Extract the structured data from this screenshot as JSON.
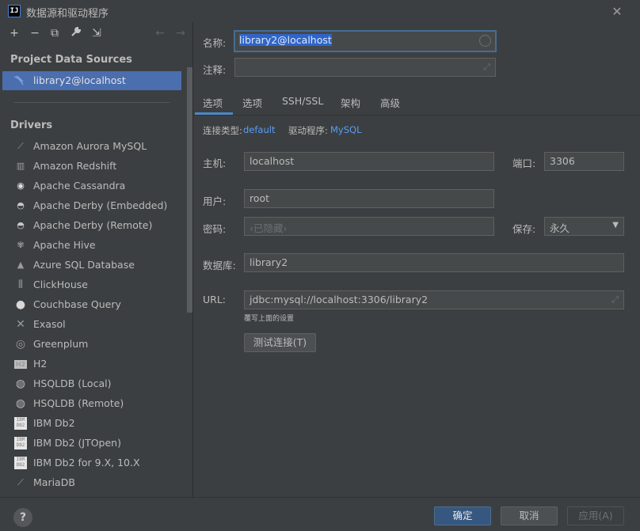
{
  "window": {
    "title": "数据源和驱动程序",
    "app_icon": "IJ",
    "close_icon": "✕"
  },
  "sidebar": {
    "toolbar": {
      "add": "+",
      "remove": "−",
      "copy": "⧉",
      "settings": "🔧",
      "import": "⇲",
      "back": "←",
      "forward": "→"
    },
    "project_section": "Project Data Sources",
    "data_sources": [
      {
        "label": "library2@localhost",
        "icon": "mysql-icon"
      }
    ],
    "drivers_section": "Drivers",
    "drivers": [
      {
        "label": "Amazon Aurora MySQL",
        "icon": "aurora-icon",
        "glyph": "⟋"
      },
      {
        "label": "Amazon Redshift",
        "icon": "redshift-icon",
        "glyph": "▥"
      },
      {
        "label": "Apache Cassandra",
        "icon": "cassandra-icon",
        "glyph": "◉"
      },
      {
        "label": "Apache Derby (Embedded)",
        "icon": "derby-icon",
        "glyph": "◓"
      },
      {
        "label": "Apache Derby (Remote)",
        "icon": "derby-icon",
        "glyph": "◓"
      },
      {
        "label": "Apache Hive",
        "icon": "hive-icon",
        "glyph": "✾"
      },
      {
        "label": "Azure SQL Database",
        "icon": "azure-icon",
        "glyph": "▲"
      },
      {
        "label": "ClickHouse",
        "icon": "clickhouse-icon",
        "glyph": "⦀"
      },
      {
        "label": "Couchbase Query",
        "icon": "couchbase-icon",
        "glyph": "●"
      },
      {
        "label": "Exasol",
        "icon": "exasol-icon",
        "glyph": "✕"
      },
      {
        "label": "Greenplum",
        "icon": "greenplum-icon",
        "glyph": "◎"
      },
      {
        "label": "H2",
        "icon": "h2-icon",
        "glyph": "H2"
      },
      {
        "label": "HSQLDB (Local)",
        "icon": "hsqldb-icon",
        "glyph": "◍"
      },
      {
        "label": "HSQLDB (Remote)",
        "icon": "hsqldb-icon",
        "glyph": "◍"
      },
      {
        "label": "IBM Db2",
        "icon": "ibm-db2-icon",
        "glyph": "IBM DB2"
      },
      {
        "label": "IBM Db2 (JTOpen)",
        "icon": "ibm-db2-icon",
        "glyph": "IBM DB2"
      },
      {
        "label": "IBM Db2 for 9.X, 10.X",
        "icon": "ibm-db2-icon",
        "glyph": "IBM DB2"
      },
      {
        "label": "MariaDB",
        "icon": "mariadb-icon",
        "glyph": "⟋"
      }
    ]
  },
  "form": {
    "name_label": "名称:",
    "name_value": "library2@localhost",
    "comment_label": "注释:",
    "comment_value": "",
    "tabs": [
      {
        "label": "选项",
        "active": true
      },
      {
        "label": "选项",
        "active": false
      },
      {
        "label": "SSH/SSL",
        "active": false
      },
      {
        "label": "架构",
        "active": false
      },
      {
        "label": "高级",
        "active": false
      }
    ],
    "connection_type_label": "连接类型:",
    "connection_type_value": "default",
    "driver_label": "驱动程序:",
    "driver_value": "MySQL",
    "host_label": "主机:",
    "host_value": "localhost",
    "port_label": "端口:",
    "port_value": "3306",
    "user_label": "用户:",
    "user_value": "root",
    "password_label": "密码:",
    "password_placeholder": "‹已隐藏›",
    "save_label": "保存:",
    "save_value": "永久",
    "database_label": "数据库:",
    "database_value": "library2",
    "url_label": "URL:",
    "url_value": "jdbc:mysql://localhost:3306/library2",
    "url_hint": "覆写上面的设置",
    "test_connection": "测试连接(T)"
  },
  "footer": {
    "help": "?",
    "ok": "确定",
    "cancel": "取消",
    "apply": "应用(A)"
  },
  "colors": {
    "accent": "#4b6eaf",
    "link": "#589df6",
    "primary_button": "#365880",
    "background": "#3c3f41"
  }
}
